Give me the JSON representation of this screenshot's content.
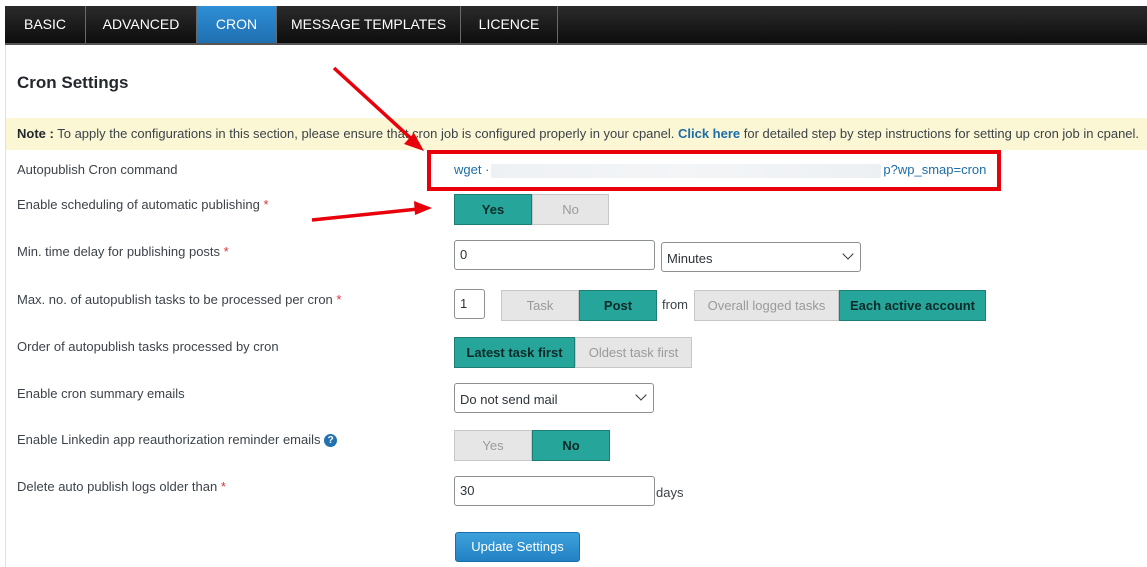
{
  "tabs": [
    {
      "label": "BASIC",
      "active": false
    },
    {
      "label": "ADVANCED",
      "active": false
    },
    {
      "label": "CRON",
      "active": true
    },
    {
      "label": "MESSAGE TEMPLATES",
      "active": false
    },
    {
      "label": "LICENCE",
      "active": false
    }
  ],
  "page_title": "Cron Settings",
  "note": {
    "prefix": "Note :",
    "text_before": " To apply the configurations in this section, please ensure that cron job is configured properly in your cpanel. ",
    "link": "Click here",
    "text_after": " for detailed step by step instructions for setting up cron job in cpanel."
  },
  "fields": {
    "cron_command": {
      "label": "Autopublish Cron command",
      "prefix": "wget ·",
      "suffix": "p?wp_smap=cron"
    },
    "enable_scheduling": {
      "label": "Enable scheduling of automatic publishing",
      "required": "*",
      "yes": "Yes",
      "no": "No",
      "selected": "Yes"
    },
    "min_delay": {
      "label": "Min. time delay for publishing posts",
      "required": "*",
      "value": "0",
      "unit": "Minutes"
    },
    "max_tasks": {
      "label": "Max. no. of autopublish tasks to be processed per cron",
      "required": "*",
      "value": "1",
      "task": "Task",
      "post": "Post",
      "selected": "Post",
      "from": "from",
      "overall": "Overall logged tasks",
      "each": "Each active account",
      "selected_scope": "Each active account"
    },
    "order": {
      "label": "Order of autopublish tasks processed by cron",
      "latest": "Latest task first",
      "oldest": "Oldest task first",
      "selected": "Latest task first"
    },
    "summary_emails": {
      "label": "Enable cron summary emails",
      "value": "Do not send mail"
    },
    "linkedin_reminder": {
      "label": "Enable Linkedin app reauthorization reminder emails",
      "yes": "Yes",
      "no": "No",
      "selected": "No"
    },
    "delete_logs": {
      "label": "Delete auto publish logs older than",
      "required": "*",
      "value": "30",
      "unit": "days"
    }
  },
  "update_button": "Update Settings",
  "colors": {
    "accent_teal": "#26a69a",
    "tab_active": "#2271b1",
    "annotation_red": "#e8000a",
    "link": "#1d6da8"
  }
}
